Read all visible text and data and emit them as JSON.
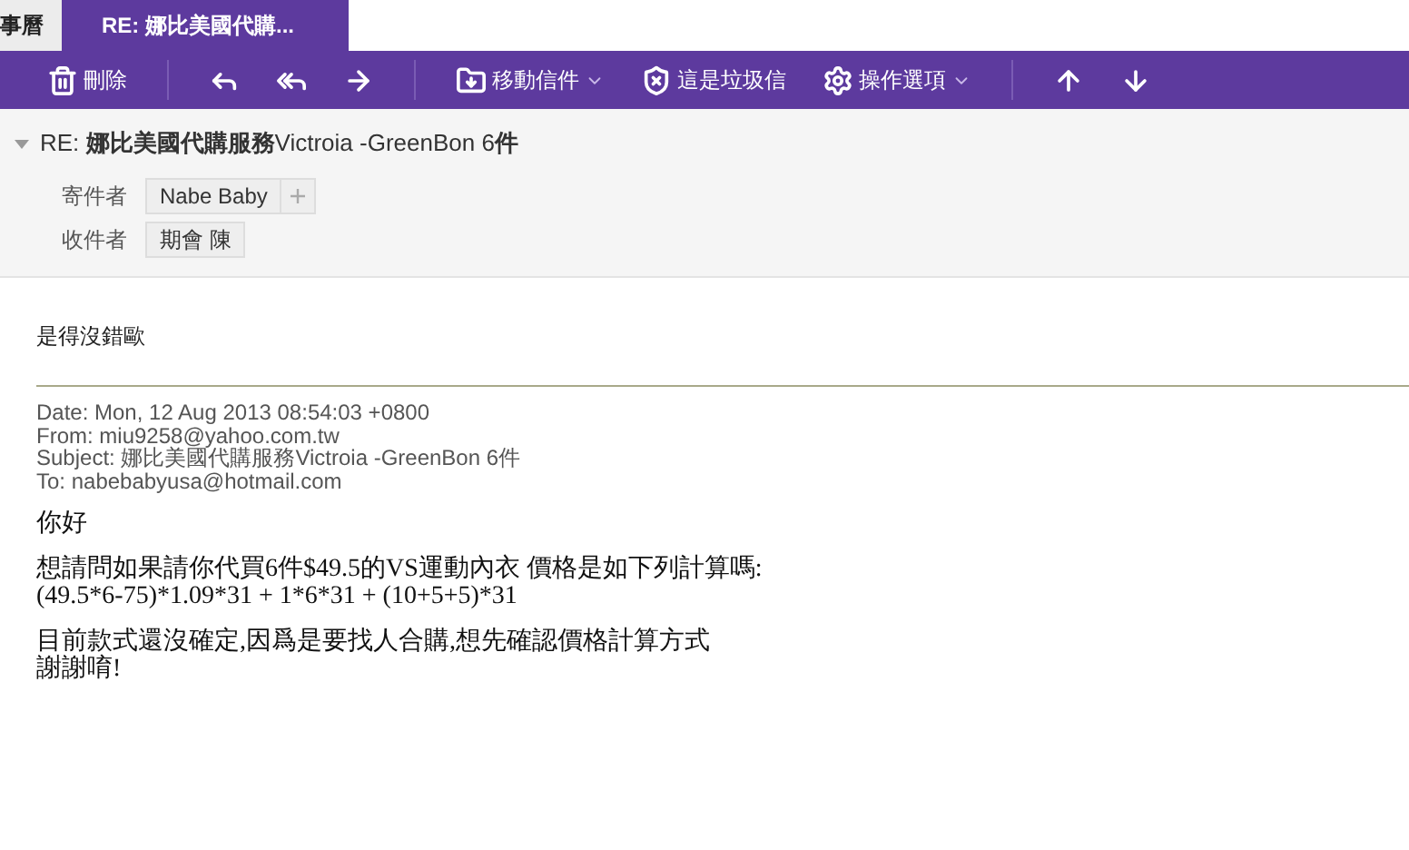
{
  "tabs": [
    {
      "label": "事曆",
      "selected": false
    },
    {
      "label": "RE: 娜比美國代購...",
      "selected": true
    }
  ],
  "toolbar": [
    {
      "kind": "delete",
      "label": "刪除"
    },
    {
      "kind": "separator"
    },
    {
      "kind": "reply"
    },
    {
      "kind": "reply_all"
    },
    {
      "kind": "forward"
    },
    {
      "kind": "separator"
    },
    {
      "kind": "move",
      "label": "移動信件",
      "dropdown": true
    },
    {
      "kind": "spam",
      "label": "這是垃圾信"
    },
    {
      "kind": "options",
      "label": "操作選項",
      "dropdown": true
    },
    {
      "kind": "separator"
    },
    {
      "kind": "previous"
    },
    {
      "kind": "next"
    }
  ],
  "message": {
    "subject": "RE: **娜比美國代購服務**Victroia -GreenBon 6**件**",
    "expanded": true,
    "fields": [
      {
        "label": "寄件者",
        "value": "Nabe Baby",
        "addable": true
      },
      {
        "label": "收件者",
        "value": "期會 陳",
        "addable": false
      }
    ],
    "reply": "是得沒錯歐",
    "quoted_header": [
      "Date: Mon, 12 Aug 2013 08:54:03 +0800",
      "From: miu9258@yahoo.com.tw",
      "Subject: 娜比美國代購服務Victroia -GreenBon 6件",
      "To: nabebabyusa@hotmail.com"
    ],
    "quoted_body": [
      [
        "你好"
      ],
      [
        "想請問如果請你代買6件$49.5的VS運動內衣 價格是如下列計算嗎:",
        "(49.5*6-75)*1.09*31 + 1*6*31 + (10+5+5)*31"
      ],
      [
        "目前款式還沒確定,因爲是要找人合購,想先確認價格計算方式",
        "謝謝唷!"
      ]
    ]
  }
}
